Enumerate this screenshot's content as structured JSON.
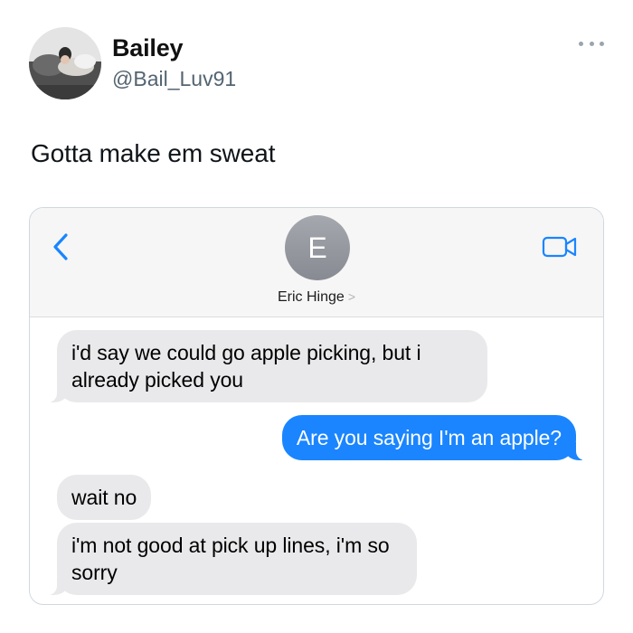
{
  "tweet": {
    "display_name": "Bailey",
    "handle": "@Bail_Luv91",
    "text": "Gotta make em sweat",
    "more_icon": "more-horizontal-icon"
  },
  "imessage": {
    "contact_initial": "E",
    "contact_name": "Eric Hinge",
    "contact_chevron": ">",
    "back_icon": "chevron-left-icon",
    "video_icon": "video-camera-icon",
    "accent_color": "#1a85ff",
    "incoming_color": "#e9e9eb",
    "messages": [
      {
        "direction": "incoming",
        "text": "i'd say we could go apple picking, but i already picked you"
      },
      {
        "direction": "outgoing",
        "text": "Are you saying I'm an apple?"
      },
      {
        "direction": "incoming",
        "text": "wait no"
      },
      {
        "direction": "incoming",
        "text": "i'm not good at pick up lines, i'm so sorry"
      }
    ]
  }
}
